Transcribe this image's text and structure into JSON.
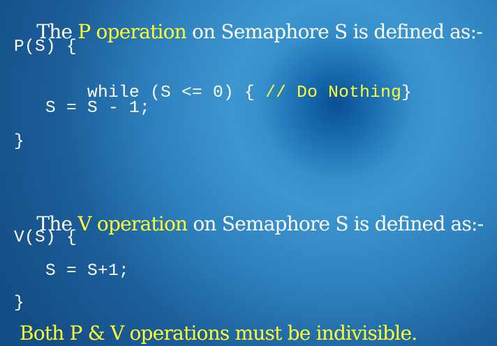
{
  "slide": {
    "p_section": {
      "heading": {
        "prefix": "The ",
        "highlight": "P operation",
        "suffix": " on Semaphore S is defined as:-"
      },
      "code": [
        "P(S) {",
        "   while (S <= 0) { ",
        "// Do Nothing",
        "}",
        "   S = S - 1;",
        "}"
      ]
    },
    "v_section": {
      "heading": {
        "prefix": "The ",
        "highlight": "V operation",
        "suffix": " on Semaphore S is defined as:-"
      },
      "code": [
        "V(S) {",
        "   S = S+1;",
        "}"
      ]
    },
    "footer": "Both P & V operations must be indivisible."
  },
  "colors": {
    "accent_yellow": "#ffff33",
    "text": "#ffffff",
    "background_center": "#0a4f95",
    "background_glow": "#3d96cf",
    "background_edge": "#124a80"
  }
}
